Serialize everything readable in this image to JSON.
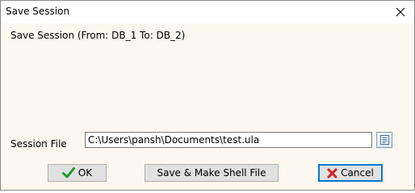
{
  "window": {
    "title": "Save Session",
    "close_icon": "close-icon"
  },
  "header": {
    "text": "Save Session (From: DB_1 To: DB_2)"
  },
  "session_file": {
    "label": "Session File",
    "value": "C:\\Users\\pansh\\Documents\\test.ula",
    "browse_icon": "browse-file-icon"
  },
  "buttons": {
    "ok_label": "OK",
    "ok_icon": "checkmark-icon",
    "shell_label": "Save & Make Shell File",
    "cancel_label": "Cancel",
    "cancel_icon": "x-icon"
  },
  "colors": {
    "dialog_background": "#fdf8ef",
    "ok_check": "#1f9d2b",
    "cancel_x": "#d21f1f",
    "focus_border": "#0078d7"
  }
}
